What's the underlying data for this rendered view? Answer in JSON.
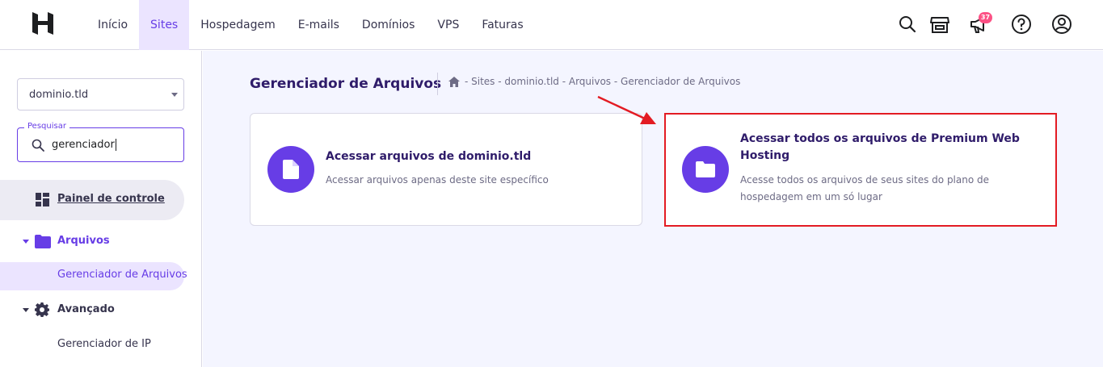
{
  "nav": {
    "items": [
      {
        "label": "Início"
      },
      {
        "label": "Sites"
      },
      {
        "label": "Hospedagem"
      },
      {
        "label": "E-mails"
      },
      {
        "label": "Domínios"
      },
      {
        "label": "VPS"
      },
      {
        "label": "Faturas"
      }
    ],
    "active": "Sites",
    "notifications_count": "37"
  },
  "sidebar": {
    "domain_select": "dominio.tld",
    "search_label": "Pesquisar",
    "search_value": "gerenciador",
    "dashboard": "Painel de controle",
    "files_group": "Arquivos",
    "files_item": "Gerenciador de Arquivos",
    "advanced_group": "Avançado",
    "advanced_item": "Gerenciador de IP"
  },
  "main": {
    "title": "Gerenciador de Arquivos",
    "breadcrumb": "- Sites - dominio.tld - Arquivos - Gerenciador de Arquivos",
    "cards": [
      {
        "title": "Acessar arquivos de dominio.tld",
        "description": "Acessar arquivos apenas deste site específico"
      },
      {
        "title_line1": "Acessar todos os arquivos de Premium Web",
        "title_line2": "Hosting",
        "description_line1": "Acesse todos os arquivos de seus sites do plano de",
        "description_line2": "hospedagem em um só lugar"
      }
    ]
  },
  "colors": {
    "accent": "#673de6",
    "highlight_box": "#e31b23",
    "badge": "#fc5185"
  },
  "icons": [
    "hostinger-logo-icon",
    "search-icon",
    "store-icon",
    "megaphone-icon",
    "help-icon",
    "account-icon",
    "dashboard-icon",
    "folder-icon",
    "gear-icon",
    "home-icon",
    "file-icon"
  ]
}
